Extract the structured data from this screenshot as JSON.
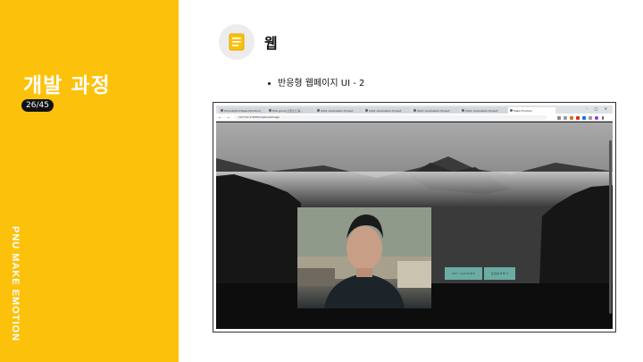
{
  "sidebar": {
    "title": "개발 과정",
    "page_indicator": "26/45",
    "vertical_label": "PNU MAKE EMOTION",
    "background_color": "#fcc10a"
  },
  "section": {
    "icon": "document-list-icon",
    "title": "웹",
    "bullet": "반응형 웹페이지 UI - 2"
  },
  "screenshot": {
    "browser": {
      "tabs": [
        "Tutorial(Pull Make Emotion)",
        "Edit group 오픈소스 팀...",
        "2021 Graduation Project",
        "2021 Graduation Project",
        "2021 Graduation Project",
        "2021 Graduation Project",
        "Make Emotion"
      ],
      "active_tab": 6,
      "url": "127.0.0.1:5000/capture/image"
    },
    "buttons": {
      "capture": "GET CAPTURE",
      "emotion": "감정분석하기"
    }
  }
}
